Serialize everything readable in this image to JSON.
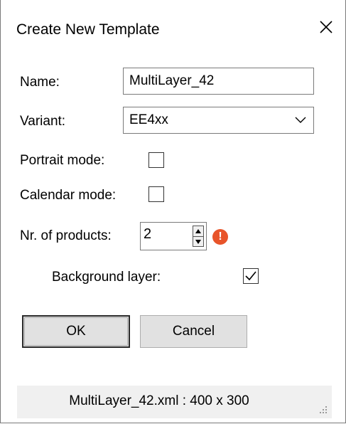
{
  "dialog": {
    "title": "Create New Template",
    "close_icon": "close-icon"
  },
  "form": {
    "name_label": "Name:",
    "name_value": "MultiLayer_42",
    "variant_label": "Variant:",
    "variant_value": "EE4xx",
    "portrait_label": "Portrait mode:",
    "portrait_checked": false,
    "calendar_label": "Calendar mode:",
    "calendar_checked": false,
    "products_label": "Nr. of products:",
    "products_value": "2",
    "products_error_icon": "error-icon",
    "error_color": "#e8542a",
    "background_label": "Background layer:",
    "background_checked": true
  },
  "buttons": {
    "ok_label": "OK",
    "cancel_label": "Cancel"
  },
  "status": {
    "text": "MultiLayer_42.xml : 400 x 300"
  }
}
